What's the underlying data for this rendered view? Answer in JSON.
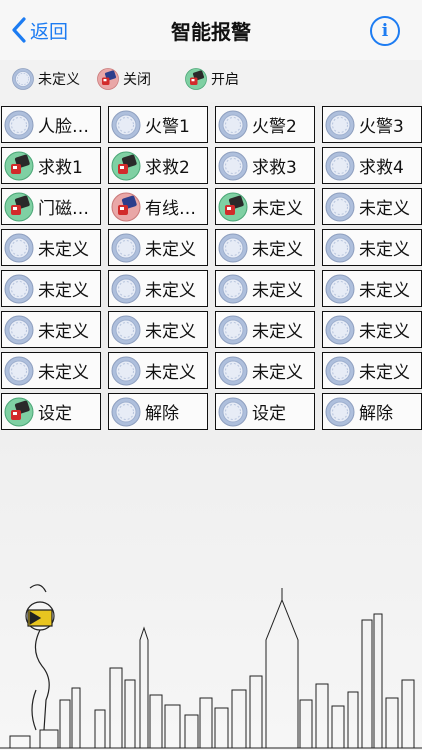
{
  "nav": {
    "back_label": "返回",
    "title": "智能报警",
    "info_glyph": "i"
  },
  "legend": [
    {
      "state": "undefined",
      "label": "未定义"
    },
    {
      "state": "off",
      "label": "关闭"
    },
    {
      "state": "on",
      "label": "开启"
    }
  ],
  "colors": {
    "accent": "#1d7cf2",
    "undefined": "#aebfdc",
    "off": "#e9a7a7",
    "on": "#7fd0a3"
  },
  "cells": [
    {
      "label": "人脸…",
      "state": "undefined"
    },
    {
      "label": "火警1",
      "state": "undefined"
    },
    {
      "label": "火警2",
      "state": "undefined"
    },
    {
      "label": "火警3",
      "state": "undefined"
    },
    {
      "label": "求救1",
      "state": "on"
    },
    {
      "label": "求救2",
      "state": "on"
    },
    {
      "label": "求救3",
      "state": "undefined"
    },
    {
      "label": "求救4",
      "state": "undefined"
    },
    {
      "label": "门磁…",
      "state": "on"
    },
    {
      "label": "有线…",
      "state": "off"
    },
    {
      "label": "未定义",
      "state": "on"
    },
    {
      "label": "未定义",
      "state": "undefined"
    },
    {
      "label": "未定义",
      "state": "undefined"
    },
    {
      "label": "未定义",
      "state": "undefined"
    },
    {
      "label": "未定义",
      "state": "undefined"
    },
    {
      "label": "未定义",
      "state": "undefined"
    },
    {
      "label": "未定义",
      "state": "undefined"
    },
    {
      "label": "未定义",
      "state": "undefined"
    },
    {
      "label": "未定义",
      "state": "undefined"
    },
    {
      "label": "未定义",
      "state": "undefined"
    },
    {
      "label": "未定义",
      "state": "undefined"
    },
    {
      "label": "未定义",
      "state": "undefined"
    },
    {
      "label": "未定义",
      "state": "undefined"
    },
    {
      "label": "未定义",
      "state": "undefined"
    },
    {
      "label": "未定义",
      "state": "undefined"
    },
    {
      "label": "未定义",
      "state": "undefined"
    },
    {
      "label": "未定义",
      "state": "undefined"
    },
    {
      "label": "未定义",
      "state": "undefined"
    },
    {
      "label": "设定",
      "state": "on"
    },
    {
      "label": "解除",
      "state": "undefined"
    },
    {
      "label": "设定",
      "state": "undefined"
    },
    {
      "label": "解除",
      "state": "undefined"
    }
  ]
}
